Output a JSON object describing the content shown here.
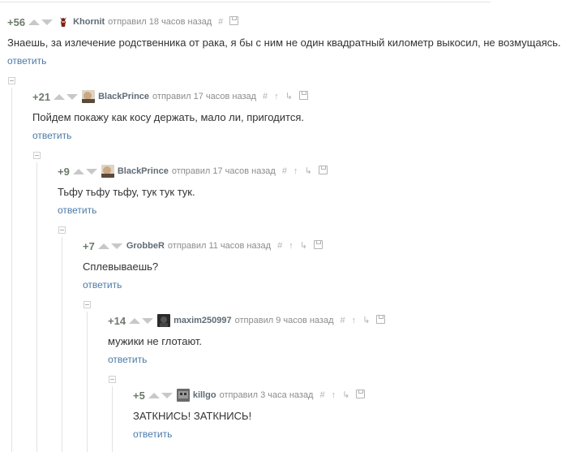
{
  "comments": [
    {
      "score": "+56",
      "author": "Khornit",
      "meta": "отправил 18 часов назад",
      "text": "Знаешь, за излечение родственника от рака, я бы с ним не один квадратный километр выкосил, не возмущаясь.",
      "reply": "ответить",
      "icons": [
        "hash-icon",
        "save-icon"
      ]
    },
    {
      "score": "+21",
      "author": "BlackPrince",
      "meta": "отправил 17 часов назад",
      "text": "Пойдем покажу как косу держать, мало ли, пригодится.",
      "reply": "ответить",
      "icons": [
        "hash-icon",
        "parent-up-icon",
        "branch-icon",
        "save-icon"
      ]
    },
    {
      "score": "+9",
      "author": "BlackPrince",
      "meta": "отправил 17 часов назад",
      "text": "Тьфу тьфу тьфу, тук тук тук.",
      "reply": "ответить",
      "icons": [
        "hash-icon",
        "parent-up-icon",
        "branch-icon",
        "save-icon"
      ]
    },
    {
      "score": "+7",
      "author": "GrobbeR",
      "meta": "отправил 11 часов назад",
      "text": "Сплевываешь?",
      "reply": "ответить",
      "icons": [
        "hash-icon",
        "parent-up-icon",
        "branch-icon",
        "save-icon"
      ]
    },
    {
      "score": "+14",
      "author": "maxim250997",
      "meta": "отправил 9 часов назад",
      "text": "мужики не глотают.",
      "reply": "ответить",
      "icons": [
        "hash-icon",
        "parent-up-icon",
        "branch-icon",
        "save-icon"
      ]
    },
    {
      "score": "+5",
      "author": "killgo",
      "meta": "отправил 3 часа назад",
      "text": "ЗАТКНИСЬ! ЗАТКНИСЬ!",
      "reply": "ответить",
      "icons": [
        "hash-icon",
        "parent-up-icon",
        "branch-icon",
        "save-icon"
      ]
    }
  ],
  "colors": {
    "score": "#6d7a6d",
    "author": "#5f6b75",
    "link": "#4a7aa8",
    "meta": "#8c8c8c"
  }
}
